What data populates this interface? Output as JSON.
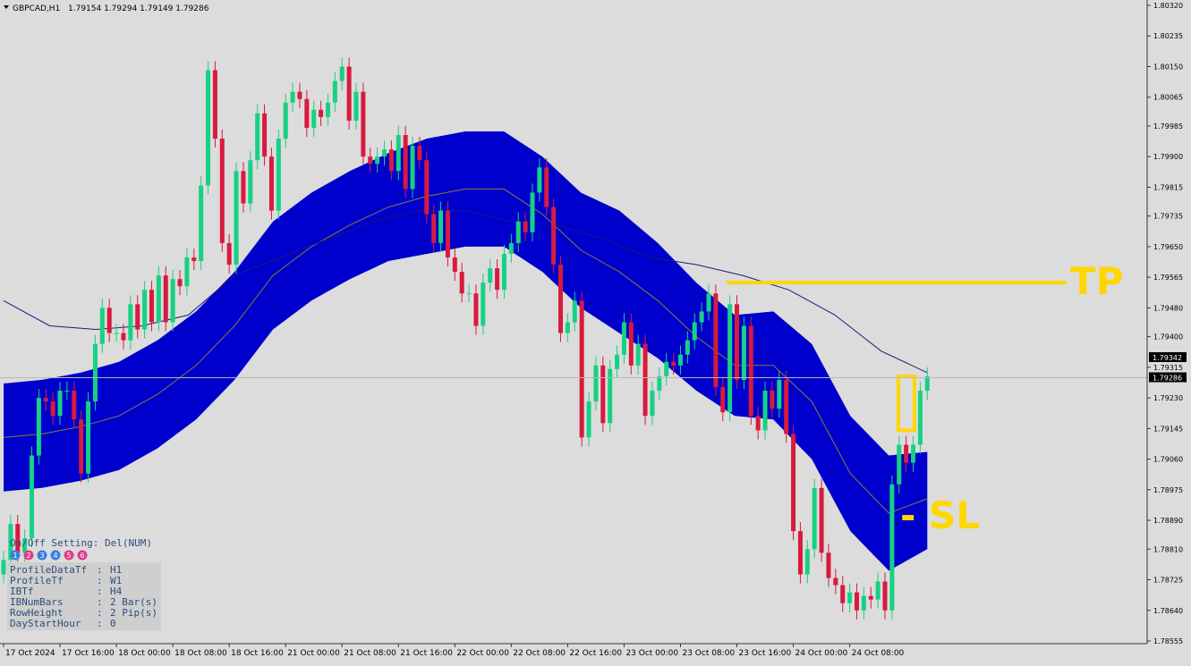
{
  "header": {
    "symbol_label": "GBPCAD,H1",
    "ohlc": "1.79154 1.79294 1.79149 1.79286"
  },
  "chart_data": {
    "type": "candlestick",
    "symbol": "GBPCAD",
    "timeframe": "H1",
    "ylim": [
      1.78555,
      1.8032
    ],
    "y_ticks": [
      "1.80320",
      "1.80235",
      "1.80150",
      "1.80065",
      "1.79985",
      "1.79900",
      "1.79815",
      "1.79735",
      "1.79650",
      "1.79565",
      "1.79480",
      "1.79400",
      "1.79315",
      "1.79230",
      "1.79145",
      "1.79060",
      "1.78975",
      "1.78890",
      "1.78810",
      "1.78725",
      "1.78640",
      "1.78555"
    ],
    "x_ticks": [
      "17 Oct 2024",
      "17 Oct 16:00",
      "18 Oct 00:00",
      "18 Oct 08:00",
      "18 Oct 16:00",
      "21 Oct 00:00",
      "21 Oct 08:00",
      "21 Oct 16:00",
      "22 Oct 00:00",
      "22 Oct 08:00",
      "22 Oct 16:00",
      "23 Oct 00:00",
      "23 Oct 08:00",
      "23 Oct 16:00",
      "24 Oct 00:00",
      "24 Oct 08:00"
    ],
    "bars_per_tick": 8,
    "price_labels": [
      {
        "text": "1.79342",
        "value": 1.79342
      },
      {
        "text": "1.79286",
        "value": 1.79286
      }
    ],
    "current_price": 1.79286,
    "close": [
      1.7878,
      1.7888,
      1.788,
      1.7884,
      1.7907,
      1.7923,
      1.7922,
      1.7918,
      1.7925,
      1.7925,
      1.7917,
      1.7902,
      1.7922,
      1.7938,
      1.7948,
      1.7941,
      1.7941,
      1.7939,
      1.7949,
      1.7942,
      1.7953,
      1.7944,
      1.7957,
      1.7944,
      1.7956,
      1.7954,
      1.7962,
      1.7961,
      1.7982,
      1.8014,
      1.7995,
      1.7966,
      1.796,
      1.7986,
      1.7977,
      1.7989,
      1.8002,
      1.799,
      1.7975,
      1.7995,
      1.8005,
      1.8008,
      1.8006,
      1.7998,
      1.8003,
      1.8001,
      1.8005,
      1.8011,
      1.8015,
      1.8,
      1.8008,
      1.799,
      1.7988,
      1.799,
      1.7992,
      1.7986,
      1.7996,
      1.7981,
      1.7993,
      1.7989,
      1.7974,
      1.7966,
      1.7975,
      1.7962,
      1.7958,
      1.7952,
      1.7952,
      1.7943,
      1.7955,
      1.7959,
      1.7953,
      1.7963,
      1.7966,
      1.7972,
      1.7969,
      1.798,
      1.7987,
      1.7976,
      1.796,
      1.7941,
      1.7944,
      1.795,
      1.7912,
      1.7922,
      1.7932,
      1.7916,
      1.7931,
      1.7935,
      1.7944,
      1.7932,
      1.7938,
      1.7918,
      1.7925,
      1.7929,
      1.7933,
      1.7932,
      1.7935,
      1.7939,
      1.7944,
      1.7947,
      1.7952,
      1.7926,
      1.7919,
      1.7949,
      1.7928,
      1.7943,
      1.7918,
      1.7914,
      1.7925,
      1.792,
      1.7928,
      1.7913,
      1.7886,
      1.7874,
      1.7881,
      1.7898,
      1.788,
      1.7873,
      1.7871,
      1.7866,
      1.7869,
      1.7864,
      1.7868,
      1.7867,
      1.7872,
      1.7864,
      1.7899,
      1.791,
      1.7905,
      1.791,
      1.7925,
      1.7929
    ],
    "band": {
      "upper": [
        1.7927,
        1.7928,
        1.793,
        1.7933,
        1.7939,
        1.7947,
        1.7958,
        1.7972,
        1.798,
        1.7986,
        1.7991,
        1.7995,
        1.7997,
        1.7997,
        1.799,
        1.798,
        1.7975,
        1.7966,
        1.7955,
        1.7946,
        1.7947,
        1.7938,
        1.7918,
        1.7907,
        1.7908
      ],
      "mid": [
        1.7912,
        1.7913,
        1.7915,
        1.7918,
        1.7924,
        1.7932,
        1.7943,
        1.7957,
        1.7965,
        1.7971,
        1.7976,
        1.7979,
        1.7981,
        1.7981,
        1.7974,
        1.7964,
        1.7958,
        1.795,
        1.794,
        1.7932,
        1.7932,
        1.7922,
        1.7902,
        1.7891,
        1.7895
      ],
      "lower": [
        1.7897,
        1.7898,
        1.79,
        1.7903,
        1.7909,
        1.7917,
        1.7928,
        1.7942,
        1.795,
        1.7956,
        1.7961,
        1.7963,
        1.7965,
        1.7965,
        1.7958,
        1.7948,
        1.7941,
        1.7934,
        1.7925,
        1.7918,
        1.7917,
        1.7906,
        1.7886,
        1.7875,
        1.7881
      ],
      "color": "#0000cc"
    },
    "ma_line": {
      "values": [
        1.795,
        1.7943,
        1.7942,
        1.7943,
        1.7946,
        1.7957,
        1.7962,
        1.7967,
        1.7972,
        1.7975,
        1.7975,
        1.7972,
        1.7971,
        1.7967,
        1.7962,
        1.796,
        1.7957,
        1.7953,
        1.7946,
        1.7936,
        1.793
      ],
      "color": "#1a1a7a"
    },
    "annotations": [
      {
        "type": "line",
        "label": "TP",
        "value": 1.7955,
        "color": "#ffd700"
      },
      {
        "type": "label",
        "text": "- SL",
        "value": 1.789,
        "color": "#ffd700"
      },
      {
        "type": "box",
        "value_top": 1.7929,
        "value_bottom": 1.7914,
        "color": "#ffd700"
      }
    ],
    "colors": {
      "bull": "#16d184",
      "bear": "#d81a3d",
      "background": "#dcdcdc",
      "axis": "#333333"
    }
  },
  "info_panel": {
    "toggle_text": "On/Off Setting: Del(NUM)",
    "buttons": [
      {
        "label": "1",
        "color": "#3b7de0"
      },
      {
        "label": "2",
        "color": "#e03b8a"
      },
      {
        "label": "3",
        "color": "#3b7de0"
      },
      {
        "label": "4",
        "color": "#3b7de0"
      },
      {
        "label": "5",
        "color": "#e03b8a"
      },
      {
        "label": "6",
        "color": "#e03b8a"
      }
    ],
    "rows": [
      {
        "key": "ProfileDataTf",
        "value": "H1"
      },
      {
        "key": "ProfileTf",
        "value": "W1"
      },
      {
        "key": "IBTf",
        "value": "H4"
      },
      {
        "key": "IBNumBars",
        "value": "2 Bar(s)"
      },
      {
        "key": "RowHeight",
        "value": "2 Pip(s)"
      },
      {
        "key": "DayStartHour",
        "value": "0"
      }
    ]
  }
}
